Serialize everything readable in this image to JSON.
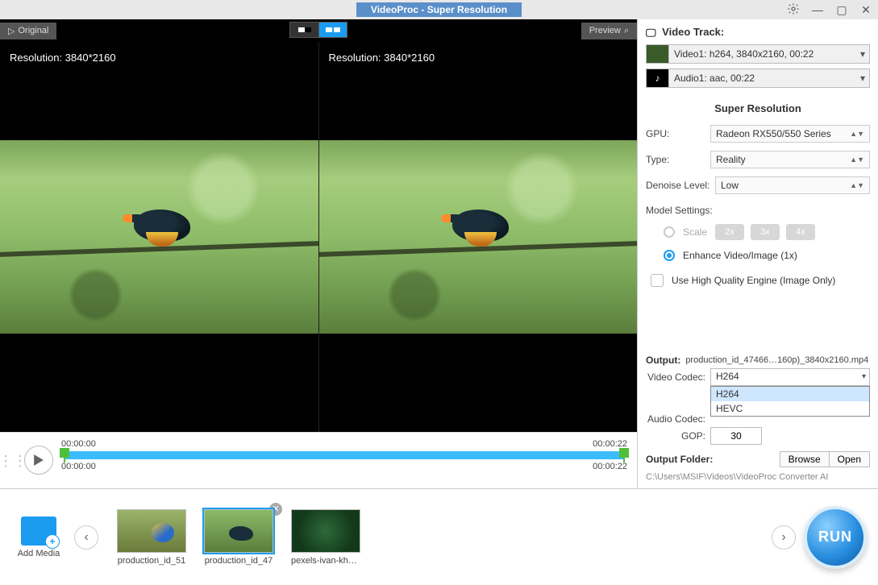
{
  "title": "VideoProc  -  Super Resolution",
  "previewBar": {
    "original": "Original",
    "preview": "Preview"
  },
  "panes": {
    "left_res": "Resolution: 3840*2160",
    "right_res": "Resolution: 3840*2160"
  },
  "timeline": {
    "top_start": "00:00:00",
    "top_end": "00:00:22",
    "bot_start": "00:00:00",
    "bot_end": "00:00:22"
  },
  "side": {
    "track_header": "Video Track:",
    "video_track": "Video1: h264, 3840x2160, 00:22",
    "audio_track": "Audio1: aac, 00:22",
    "sr_title": "Super Resolution",
    "gpu_label": "GPU:",
    "gpu_value": "Radeon RX550/550 Series",
    "type_label": "Type:",
    "type_value": "Reality",
    "denoise_label": "Denoise Level:",
    "denoise_value": "Low",
    "model_settings": "Model Settings:",
    "scale_label": "Scale",
    "scale_2x": "2x",
    "scale_3x": "3x",
    "scale_4x": "4x",
    "enhance_label": "Enhance Video/Image (1x)",
    "hq_label": "Use High Quality Engine (Image Only)",
    "output_label": "Output:",
    "output_file": "production_id_47466…160p)_3840x2160.mp4",
    "vcodec_label": "Video Codec:",
    "vcodec_value": "H264",
    "vcodec_opts": [
      "H264",
      "HEVC"
    ],
    "acodec_label": "Audio Codec:",
    "gop_label": "GOP:",
    "gop_value": "30",
    "folder_label": "Output Folder:",
    "browse": "Browse",
    "open": "Open",
    "folder_path": "C:\\Users\\MSIF\\Videos\\VideoProc Converter AI"
  },
  "bottom": {
    "add_media": "Add Media",
    "clips": [
      {
        "name": "production_id_51"
      },
      {
        "name": "production_id_47"
      },
      {
        "name": "pexels-ivan-khme"
      }
    ],
    "run": "RUN"
  }
}
